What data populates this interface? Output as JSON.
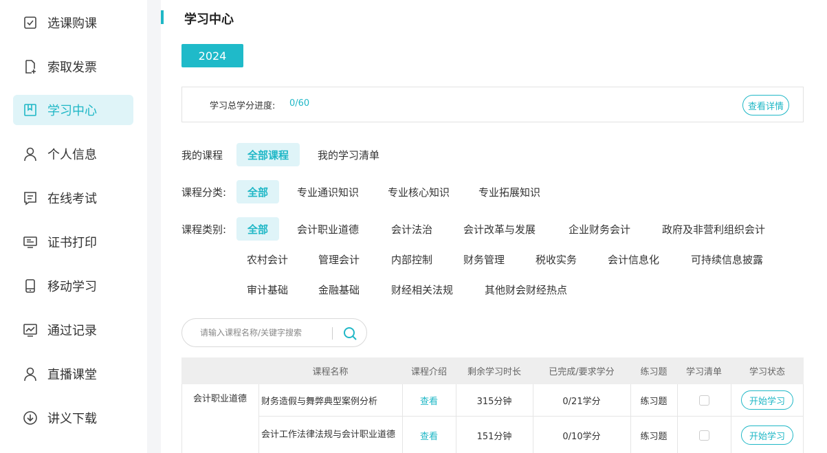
{
  "sidebar": {
    "items": [
      {
        "label": "选课购课",
        "icon": "checkbox-icon",
        "active": false
      },
      {
        "label": "索取发票",
        "icon": "invoice-add-icon",
        "active": false
      },
      {
        "label": "学习中心",
        "icon": "bookmark-book-icon",
        "active": true
      },
      {
        "label": "个人信息",
        "icon": "user-icon",
        "active": false
      },
      {
        "label": "在线考试",
        "icon": "exam-icon",
        "active": false
      },
      {
        "label": "证书打印",
        "icon": "monitor-icon",
        "active": false
      },
      {
        "label": "移动学习",
        "icon": "mobile-icon",
        "active": false
      },
      {
        "label": "通过记录",
        "icon": "chart-record-icon",
        "active": false
      },
      {
        "label": "直播课堂",
        "icon": "user-live-icon",
        "active": false
      },
      {
        "label": "讲义下载",
        "icon": "download-icon",
        "active": false
      }
    ]
  },
  "header": {
    "title": "学习中心"
  },
  "year": "2024",
  "progress": {
    "label": "学习总学分进度:",
    "value": "0/60",
    "detail_label": "查看详情"
  },
  "my_course": {
    "title": "我的课程",
    "options": [
      "全部课程",
      "我的学习清单"
    ]
  },
  "course_class": {
    "title": "课程分类:",
    "options": [
      "全部",
      "专业通识知识",
      "专业核心知识",
      "专业拓展知识"
    ]
  },
  "course_type": {
    "title": "课程类别:",
    "row1": [
      "全部",
      "会计职业道德",
      "会计法治",
      "会计改革与发展",
      "企业财务会计",
      "政府及非营利组织会计"
    ],
    "row2": [
      "农村会计",
      "管理会计",
      "内部控制",
      "财务管理",
      "税收实务",
      "会计信息化",
      "可持续信息披露"
    ],
    "row3": [
      "审计基础",
      "金融基础",
      "财经相关法规",
      "其他财会财经热点"
    ]
  },
  "search": {
    "placeholder": "请输入课程名称/关键字搜索"
  },
  "table": {
    "headers": [
      "课程名称",
      "课程介绍",
      "剩余学习时长",
      "已完成/要求学分",
      "练习题",
      "学习清单",
      "学习状态"
    ],
    "group": "会计职业道德",
    "rows": [
      {
        "name": "财务造假与舞弊典型案例分析",
        "intro": "查看",
        "remaining": "315分钟",
        "credits": "0/21学分",
        "exercise": "练习题",
        "status": "开始学习"
      },
      {
        "name": "会计工作法律法规与会计职业道德",
        "intro": "查看",
        "remaining": "151分钟",
        "credits": "0/10学分",
        "exercise": "练习题",
        "status": "开始学习"
      }
    ]
  },
  "colors": {
    "accent": "#1fb7c6",
    "active_bg": "#dff4f8"
  }
}
